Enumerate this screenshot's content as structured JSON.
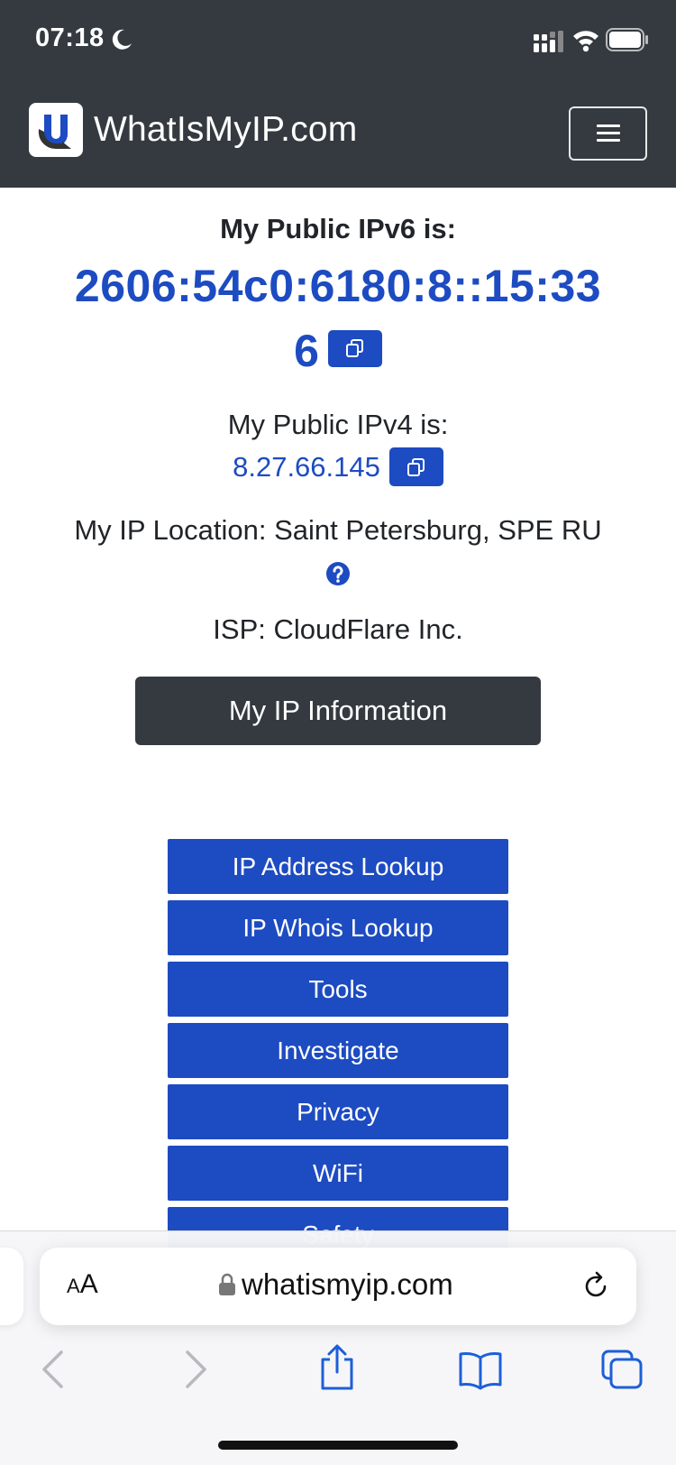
{
  "status_bar": {
    "time": "07:18"
  },
  "navbar": {
    "brand_name": "WhatIsMyIP.com"
  },
  "ipv6": {
    "label": "My Public IPv6 is:",
    "address_line1": "2606:54c0:6180:8::15:33",
    "address_line2": "6"
  },
  "ipv4": {
    "label": "My Public IPv4 is:",
    "address": "8.27.66.145"
  },
  "location": {
    "text": "My IP Location: Saint Petersburg, SPE RU"
  },
  "isp": {
    "text": "ISP: CloudFlare Inc."
  },
  "info_button": {
    "label": "My IP Information"
  },
  "nav_menu": {
    "items": [
      {
        "label": "IP Address Lookup"
      },
      {
        "label": "IP Whois Lookup"
      },
      {
        "label": "Tools"
      },
      {
        "label": "Investigate"
      },
      {
        "label": "Privacy"
      },
      {
        "label": "WiFi"
      },
      {
        "label": "Safety"
      }
    ]
  },
  "browser": {
    "aa_small": "A",
    "aa_large": "A",
    "url": "whatismyip.com"
  },
  "colors": {
    "navbar_bg": "#343a40",
    "accent_blue": "#1d4bc1",
    "text_dark": "#212529"
  }
}
